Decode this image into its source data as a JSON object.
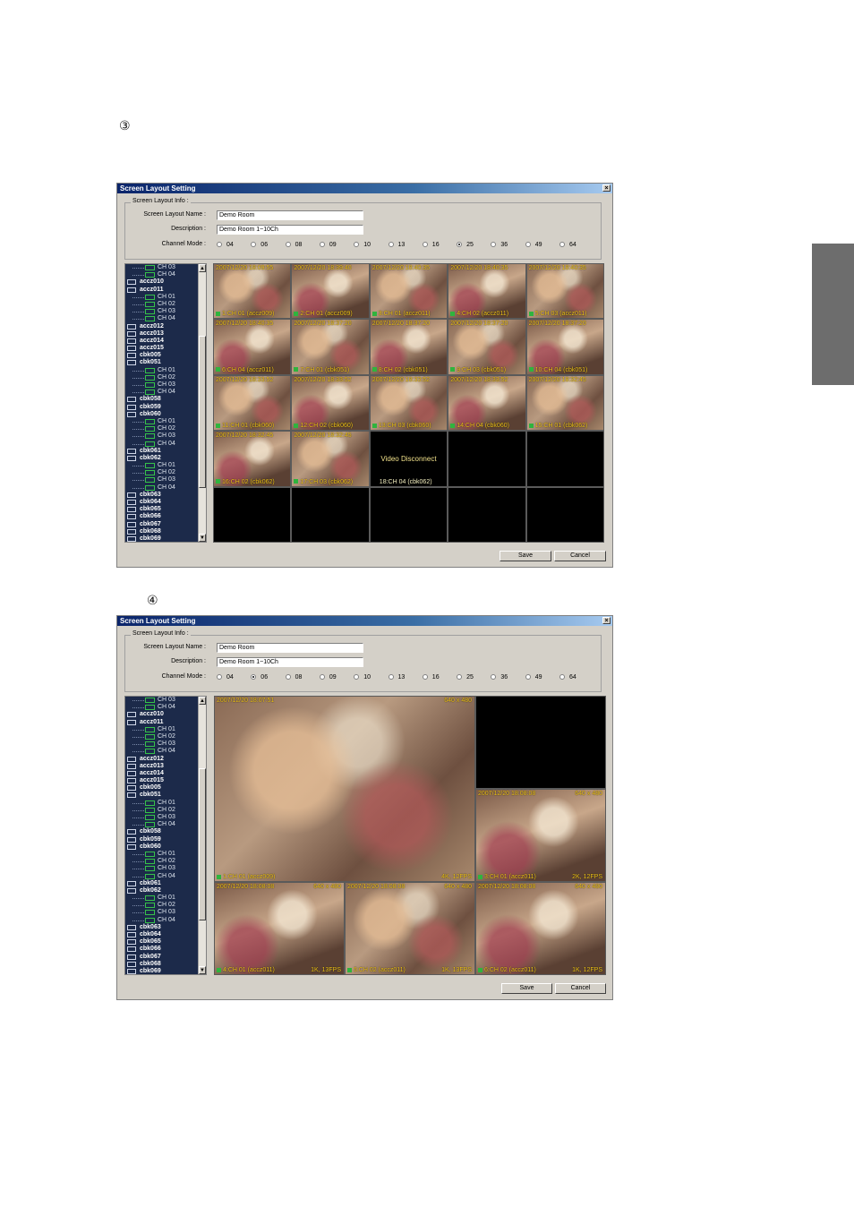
{
  "steps": {
    "three": "③",
    "four": "④"
  },
  "dialog1": {
    "title": "Screen Layout Setting",
    "close": "×",
    "group_label": "Screen Layout Info :",
    "name_label": "Screen Layout Name :",
    "name_value": "Demo Room",
    "desc_label": "Description :",
    "desc_value": "Demo Room 1~10Ch",
    "mode_label": "Channel Mode :",
    "modes": [
      "04",
      "06",
      "08",
      "09",
      "10",
      "13",
      "16",
      "25",
      "36",
      "49",
      "64"
    ],
    "selected_mode": "25",
    "tree": [
      {
        "t": "ch",
        "label": "CH 03"
      },
      {
        "t": "ch",
        "label": "CH 04"
      },
      {
        "t": "dev",
        "label": "accz010"
      },
      {
        "t": "dev",
        "label": "accz011"
      },
      {
        "t": "ch",
        "label": "CH 01"
      },
      {
        "t": "ch",
        "label": "CH 02"
      },
      {
        "t": "ch",
        "label": "CH 03"
      },
      {
        "t": "ch",
        "label": "CH 04"
      },
      {
        "t": "dev",
        "label": "accz012"
      },
      {
        "t": "dev",
        "label": "accz013"
      },
      {
        "t": "dev",
        "label": "accz014"
      },
      {
        "t": "dev",
        "label": "accz015"
      },
      {
        "t": "dev",
        "label": "cbk005"
      },
      {
        "t": "dev",
        "label": "cbk051"
      },
      {
        "t": "ch",
        "label": "CH 01"
      },
      {
        "t": "ch",
        "label": "CH 02"
      },
      {
        "t": "ch",
        "label": "CH 03"
      },
      {
        "t": "ch",
        "label": "CH 04"
      },
      {
        "t": "dev",
        "label": "cbk058"
      },
      {
        "t": "dev",
        "label": "cbk059"
      },
      {
        "t": "dev",
        "label": "cbk060"
      },
      {
        "t": "ch",
        "label": "CH 01"
      },
      {
        "t": "ch",
        "label": "CH 02"
      },
      {
        "t": "ch",
        "label": "CH 03"
      },
      {
        "t": "ch",
        "label": "CH 04"
      },
      {
        "t": "dev",
        "label": "cbk061"
      },
      {
        "t": "dev",
        "label": "cbk062"
      },
      {
        "t": "ch",
        "label": "CH 01"
      },
      {
        "t": "ch",
        "label": "CH 02"
      },
      {
        "t": "ch",
        "label": "CH 03"
      },
      {
        "t": "ch",
        "label": "CH 04"
      },
      {
        "t": "dev",
        "label": "cbk063"
      },
      {
        "t": "dev",
        "label": "cbk064"
      },
      {
        "t": "dev",
        "label": "cbk065"
      },
      {
        "t": "dev",
        "label": "cbk066"
      },
      {
        "t": "dev",
        "label": "cbk067"
      },
      {
        "t": "dev",
        "label": "cbk068"
      },
      {
        "t": "dev",
        "label": "cbk069"
      }
    ],
    "cells": [
      {
        "ts": "2007/12/20 18:09:55",
        "label": "1:CH 01 (accz009)"
      },
      {
        "ts": "2007/12/20 18:39:40",
        "label": "2:CH 01 (accz009)"
      },
      {
        "ts": "2007/12/20 18:40:35",
        "label": "3:CH 01 (accz011)"
      },
      {
        "ts": "2007/12/20 18:40:35",
        "label": "4:CH 02 (accz011)"
      },
      {
        "ts": "2007/12/20 18:40:35",
        "label": "5:CH 03 (accz011)"
      },
      {
        "ts": "2007/12/20 18:40:35",
        "label": "6:CH 04 (accz011)"
      },
      {
        "ts": "2007/12/20 18:37:20",
        "label": "7:CH 01 (cbk051)"
      },
      {
        "ts": "2007/12/20 18:37:20",
        "label": "8:CH 02 (cbk051)"
      },
      {
        "ts": "2007/12/20 18:37:20",
        "label": "9:CH 03 (cbk051)"
      },
      {
        "ts": "2007/12/20 18:37:20",
        "label": "10:CH 04 (cbk051)"
      },
      {
        "ts": "2007/12/20 18:33:52",
        "label": "11:CH 01 (cbk060)"
      },
      {
        "ts": "2007/12/20 18:33:52",
        "label": "12:CH 02 (cbk060)"
      },
      {
        "ts": "2007/12/20 18:33:52",
        "label": "13:CH 03 (cbk060)"
      },
      {
        "ts": "2007/12/20 18:33:52",
        "label": "14:CH 04 (cbk060)"
      },
      {
        "ts": "2007/12/20 18:32:45",
        "label": "15:CH 01 (cbk062)"
      },
      {
        "ts": "2007/12/20 18:32:45",
        "label": "16:CH 02 (cbk062)"
      },
      {
        "ts": "2007/12/20 18:32:45",
        "label": "17:CH 03 (cbk062)"
      },
      {
        "disc": "Video Disconnect",
        "label": "18:CH 04 (cbk062)"
      }
    ],
    "save": "Save",
    "cancel": "Cancel"
  },
  "dialog2": {
    "title": "Screen Layout Setting",
    "close": "×",
    "group_label": "Screen Layout Info :",
    "name_label": "Screen Layout Name :",
    "name_value": "Demo Room",
    "desc_label": "Description :",
    "desc_value": "Demo Room 1~10Ch",
    "mode_label": "Channel Mode :",
    "modes": [
      "04",
      "06",
      "08",
      "09",
      "10",
      "13",
      "16",
      "25",
      "36",
      "49",
      "64"
    ],
    "selected_mode": "06",
    "big": {
      "ts": "2007/12/20 18:07:51",
      "res": "640 x 480",
      "label": "1:CH 01 (accz009)",
      "fps": "4K, 12FPS"
    },
    "mid": {
      "ts": "2007/12/20 18:08:08",
      "res": "640 x 480",
      "label": "3:CH 01 (accz011)",
      "fps": "2K, 12FPS"
    },
    "bottom": [
      {
        "ts": "2007/12/20 18:08:08",
        "res": "640 x 480",
        "label": "4:CH 01 (accz011)",
        "fps": "1K, 13FPS"
      },
      {
        "ts": "2007/12/20 18:08:08",
        "res": "640 x 480",
        "label": "5:CH 02 (accz011)",
        "fps": "1K, 13FPS"
      },
      {
        "ts": "2007/12/20 18:08:08",
        "res": "640 x 480",
        "label": "6:CH 02 (accz011)",
        "fps": "1K, 12FPS"
      }
    ],
    "save": "Save",
    "cancel": "Cancel"
  }
}
